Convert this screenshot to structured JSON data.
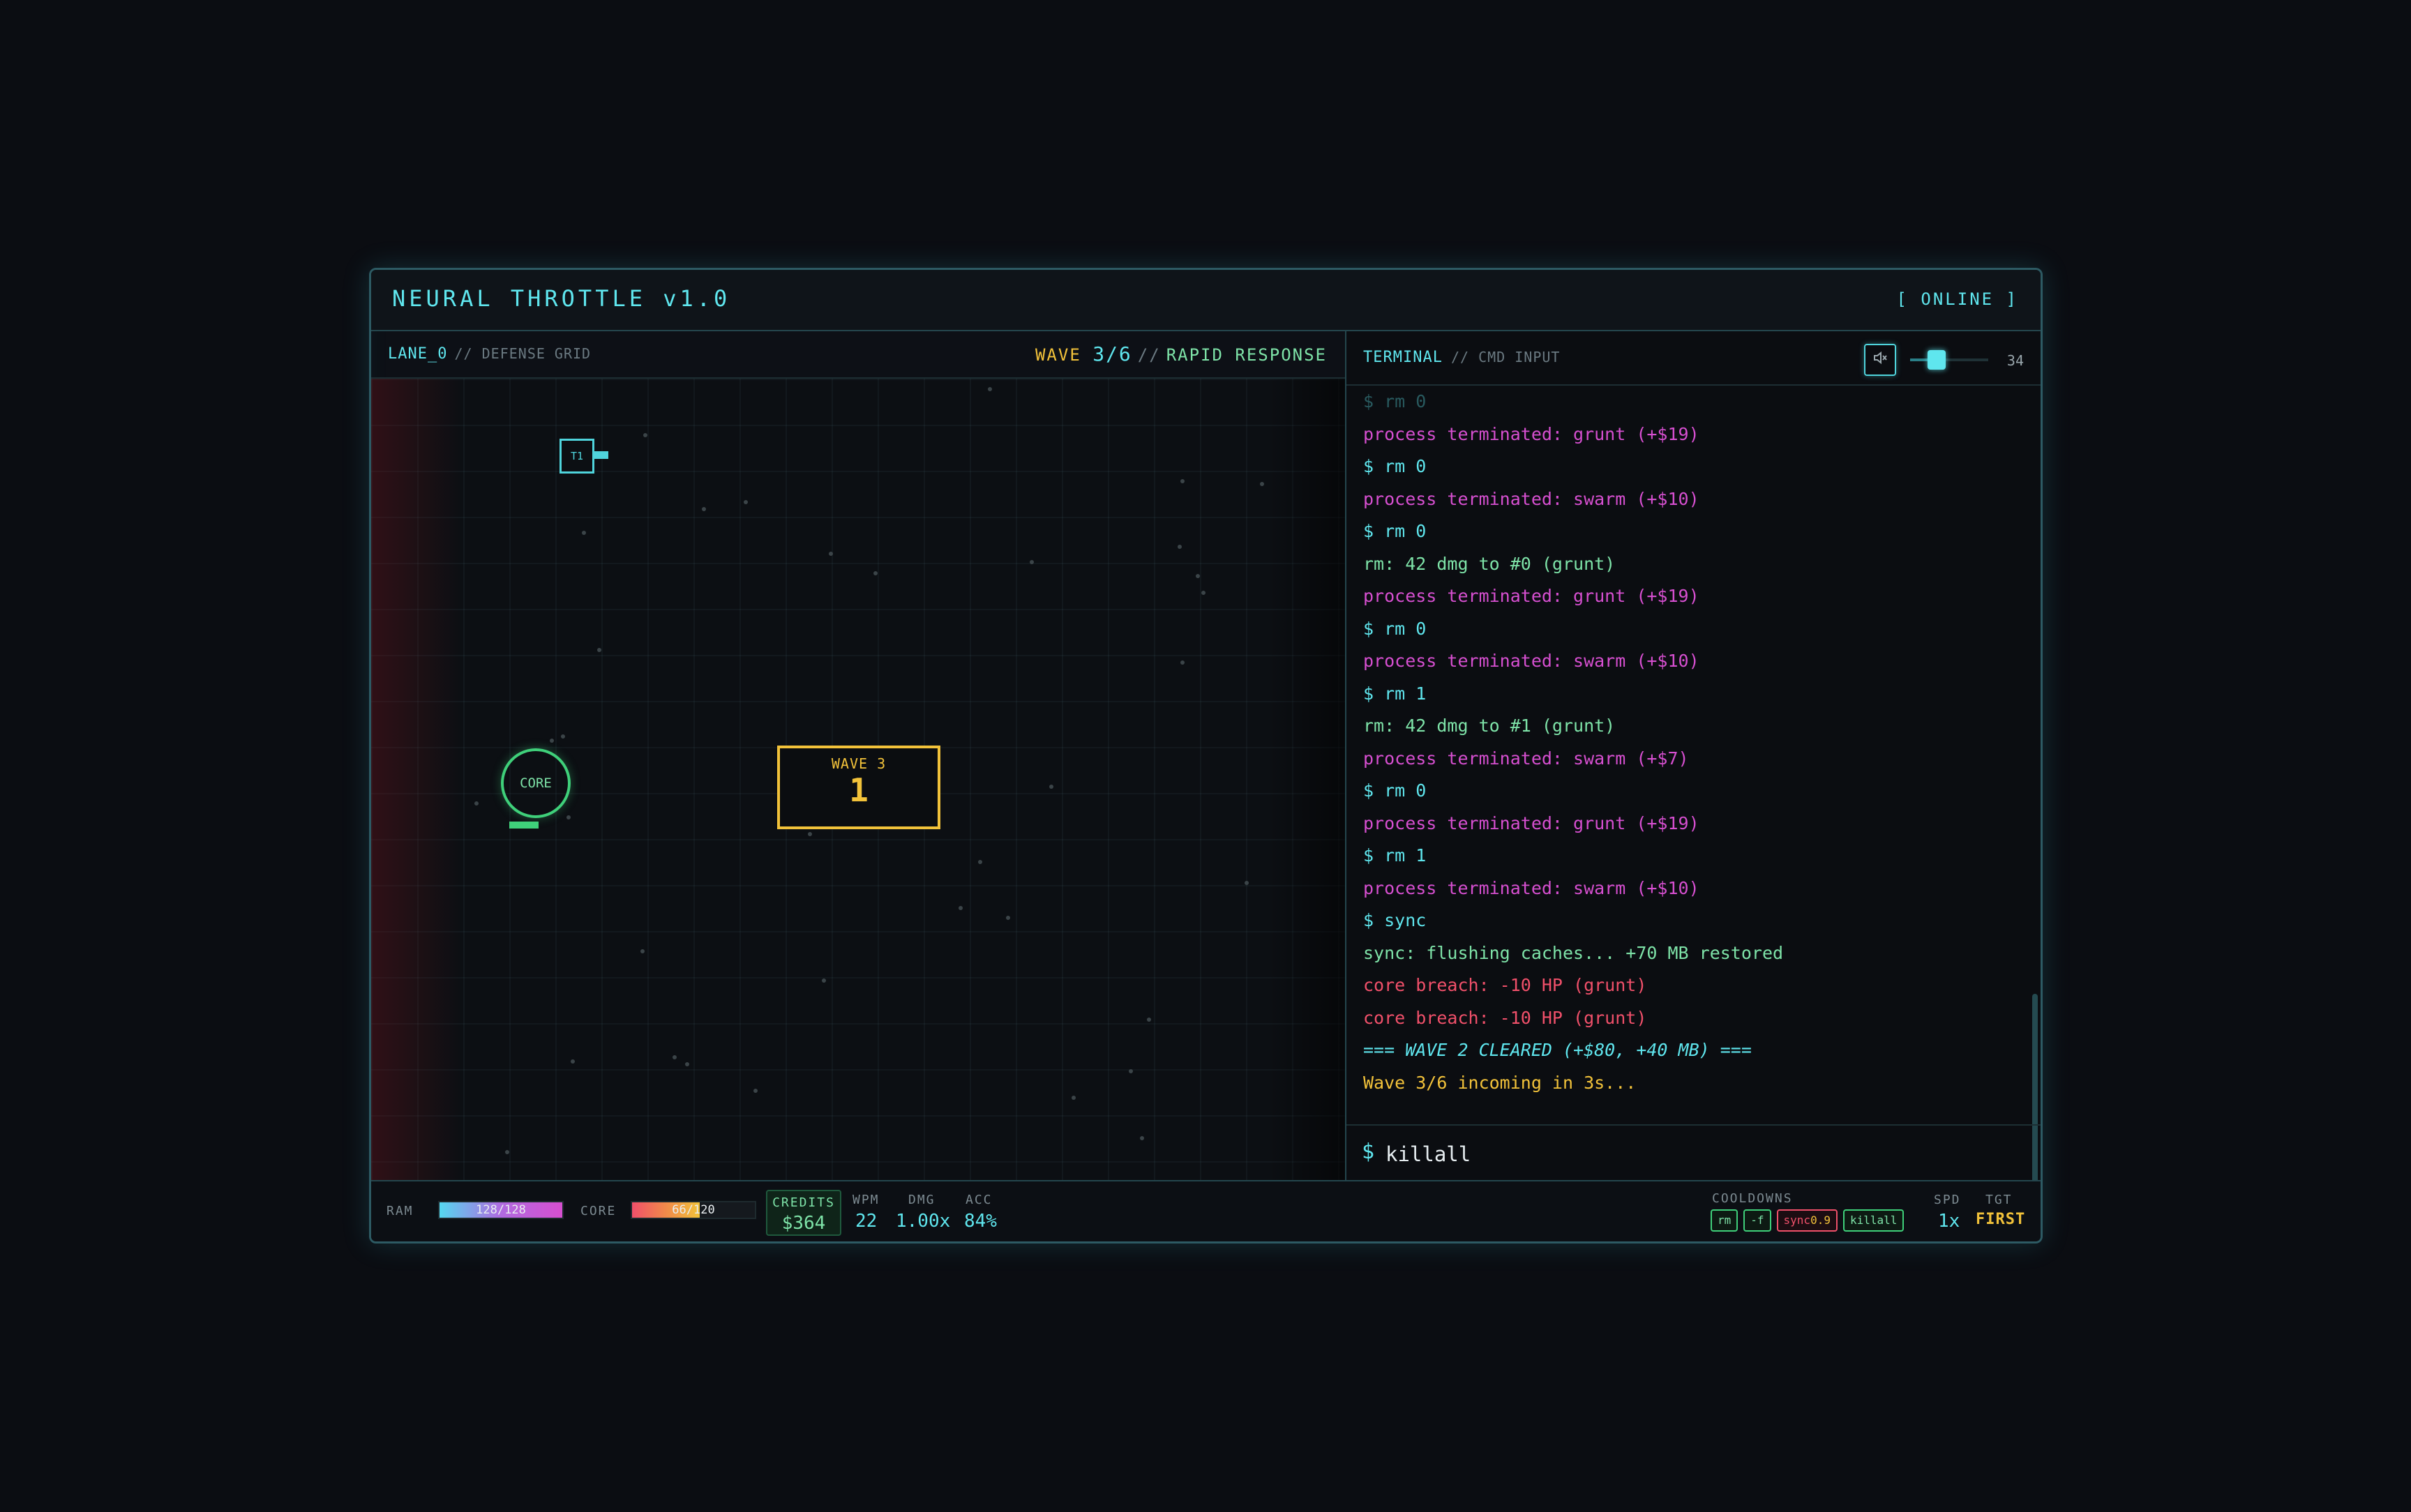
{
  "app": {
    "title": "NEURAL THROTTLE v1.0",
    "status": "[ ONLINE ]"
  },
  "game": {
    "lane_label": "LANE_0",
    "lane_sub": "// DEFENSE GRID",
    "wave_word": "WAVE",
    "wave_num": "3/6",
    "wave_sep": "//",
    "wave_name": "RAPID RESPONSE",
    "turret_label": "T1",
    "core_label": "CORE",
    "banner_label": "WAVE 3",
    "banner_count": "1"
  },
  "terminal": {
    "title": "TERMINAL",
    "sub": "// CMD INPUT",
    "volume": "34",
    "volume_fraction": 0.34,
    "prompt": "$",
    "input_value": "killall",
    "lines": [
      {
        "text": "$ rm 0",
        "kind": "cmd",
        "faded": true
      },
      {
        "text": "process terminated: grunt (+$19)",
        "kind": "kill"
      },
      {
        "text": "$ rm 0",
        "kind": "cmd"
      },
      {
        "text": "process terminated: swarm (+$10)",
        "kind": "kill"
      },
      {
        "text": "$ rm 0",
        "kind": "cmd"
      },
      {
        "text": "rm: 42 dmg to #0 (grunt)",
        "kind": "dmg"
      },
      {
        "text": "process terminated: grunt (+$19)",
        "kind": "kill"
      },
      {
        "text": "$ rm 0",
        "kind": "cmd"
      },
      {
        "text": "process terminated: swarm (+$10)",
        "kind": "kill"
      },
      {
        "text": "$ rm 1",
        "kind": "cmd"
      },
      {
        "text": "rm: 42 dmg to #1 (grunt)",
        "kind": "dmg"
      },
      {
        "text": "process terminated: swarm (+$7)",
        "kind": "kill"
      },
      {
        "text": "$ rm 0",
        "kind": "cmd"
      },
      {
        "text": "process terminated: grunt (+$19)",
        "kind": "kill"
      },
      {
        "text": "$ rm 1",
        "kind": "cmd"
      },
      {
        "text": "process terminated: swarm (+$10)",
        "kind": "kill"
      },
      {
        "text": "$ sync",
        "kind": "cmd"
      },
      {
        "text": "sync: flushing caches... +70 MB restored",
        "kind": "info"
      },
      {
        "text": "core breach: -10 HP (grunt)",
        "kind": "err"
      },
      {
        "text": "core breach: -10 HP (grunt)",
        "kind": "err"
      },
      {
        "text": "=== WAVE 2 CLEARED (+$80, +40 MB) ===",
        "kind": "clear"
      },
      {
        "text": "Wave 3/6 incoming in 3s...",
        "kind": "warn"
      }
    ]
  },
  "footer": {
    "ram_label": "RAM",
    "ram_text": "128/128",
    "ram_fraction": 1.0,
    "core_label": "CORE",
    "core_text": "66/120",
    "core_fraction": 0.55,
    "credits_label": "CREDITS",
    "credits_value": "$364",
    "wpm_label": "WPM",
    "wpm_value": "22",
    "dmg_label": "DMG",
    "dmg_value": "1.00x",
    "acc_label": "ACC",
    "acc_value": "84%",
    "cooldowns_label": "COOLDOWNS",
    "cooldowns": [
      {
        "name": "rm",
        "timer": "",
        "busy": false
      },
      {
        "name": "-f",
        "timer": "",
        "busy": false
      },
      {
        "name": "sync",
        "timer": "0.9",
        "busy": true
      },
      {
        "name": "killall",
        "timer": "",
        "busy": false
      }
    ],
    "spd_label": "SPD",
    "spd_value": "1x",
    "tgt_label": "TGT",
    "tgt_value": "FIRST"
  },
  "colors": {
    "accent": "#5fe6ee",
    "kill": "#d64fd0",
    "ok": "#7ee3a8",
    "error": "#f0506a",
    "warn": "#f2c23a"
  }
}
